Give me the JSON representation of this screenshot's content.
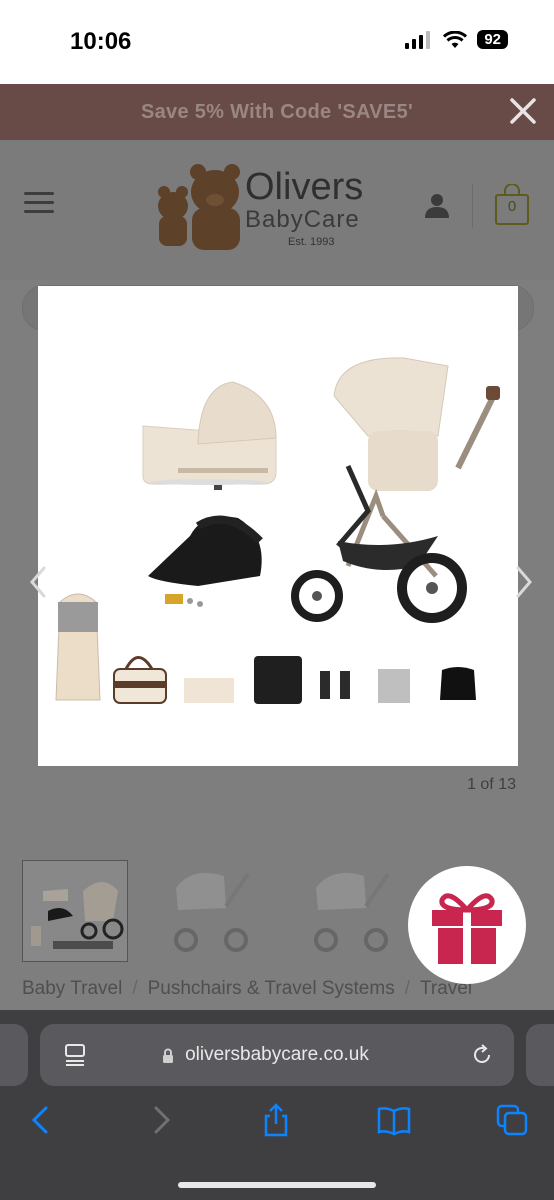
{
  "status_bar": {
    "time": "10:06",
    "battery": "92"
  },
  "promo": {
    "text": "Save 5% With Code 'SAVE5'"
  },
  "header": {
    "logo_name": "Olivers",
    "logo_sub": "BabyCare",
    "logo_est": "Est. 1993",
    "cart_count": "0"
  },
  "gallery": {
    "counter": "1 of 13"
  },
  "breadcrumb": {
    "items": [
      "Baby Travel",
      "Pushchairs & Travel Systems",
      "Travel"
    ]
  },
  "browser": {
    "url": "oliversbabycare.co.uk"
  },
  "colors": {
    "promo_bg": "#684b47",
    "gift_red": "#c8264f",
    "link_blue": "#0a84ff"
  }
}
